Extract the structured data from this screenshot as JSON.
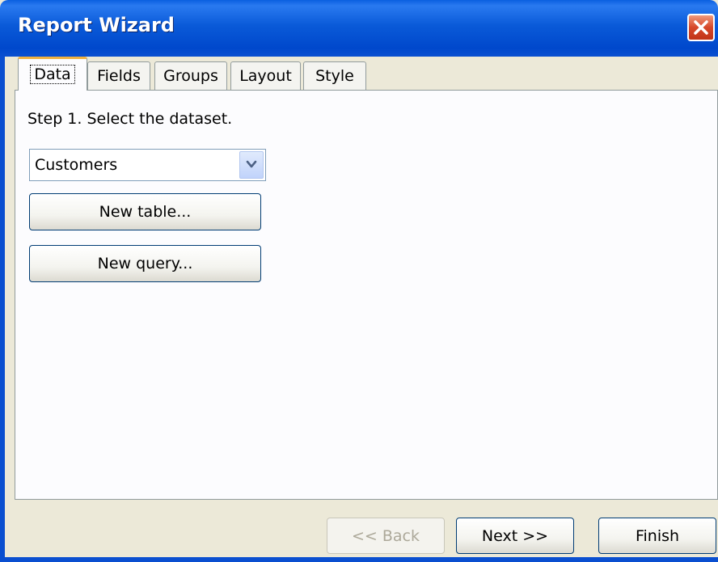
{
  "window": {
    "title": "Report Wizard"
  },
  "tabs": [
    {
      "label": "Data",
      "active": true
    },
    {
      "label": "Fields",
      "active": false
    },
    {
      "label": "Groups",
      "active": false
    },
    {
      "label": "Layout",
      "active": false
    },
    {
      "label": "Style",
      "active": false
    }
  ],
  "data_tab": {
    "step_label": "Step 1. Select the dataset.",
    "dataset_value": "Customers",
    "new_table_label": "New table...",
    "new_query_label": "New query..."
  },
  "footer": {
    "back_label": "<< Back",
    "next_label": "Next >>",
    "finish_label": "Finish"
  },
  "colors": {
    "titlebar": "#0a5ad8",
    "close": "#d6482a",
    "active_tab_accent": "#f0b140"
  }
}
